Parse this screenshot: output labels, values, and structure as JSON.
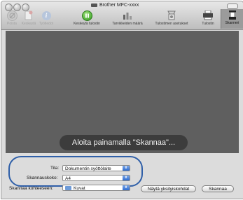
{
  "window": {
    "title": "Brother MFC-xxxx"
  },
  "toolbar": {
    "items": [
      {
        "label": "Poista",
        "icon": "delete-icon",
        "enabled": false
      },
      {
        "label": "Keskeytä",
        "icon": "hold-icon",
        "enabled": false
      },
      {
        "label": "Työtiedot",
        "icon": "info-icon",
        "enabled": false
      },
      {
        "label": "Keskeytä tulostin",
        "icon": "pause-icon",
        "enabled": true
      },
      {
        "label": "Tarvikkeiden määrä",
        "icon": "supply-levels-icon",
        "enabled": true
      },
      {
        "label": "Tulostimen asetukset",
        "icon": "printer-setup-icon",
        "enabled": true
      },
      {
        "label": "Tulostin",
        "icon": "printer-icon",
        "enabled": true
      },
      {
        "label": "Skanneri",
        "icon": "scanner-icon",
        "enabled": true,
        "selected": true
      }
    ]
  },
  "preview": {
    "message": "Aloita painamalla \"Skannaa\"..."
  },
  "form": {
    "mode_label": "Tila:",
    "mode_value": "Dokumentin syöttölaite",
    "size_label": "Skannauskoko:",
    "size_value": "A4",
    "target_label": "Skannaa kohteeseen:",
    "target_value": "Kuvat"
  },
  "buttons": {
    "details": "Näytä yksityiskohdat",
    "scan": "Skannaa"
  },
  "colors": {
    "highlight_oval": "#2f5fa8",
    "preview_bg": "#5f5f5f"
  }
}
